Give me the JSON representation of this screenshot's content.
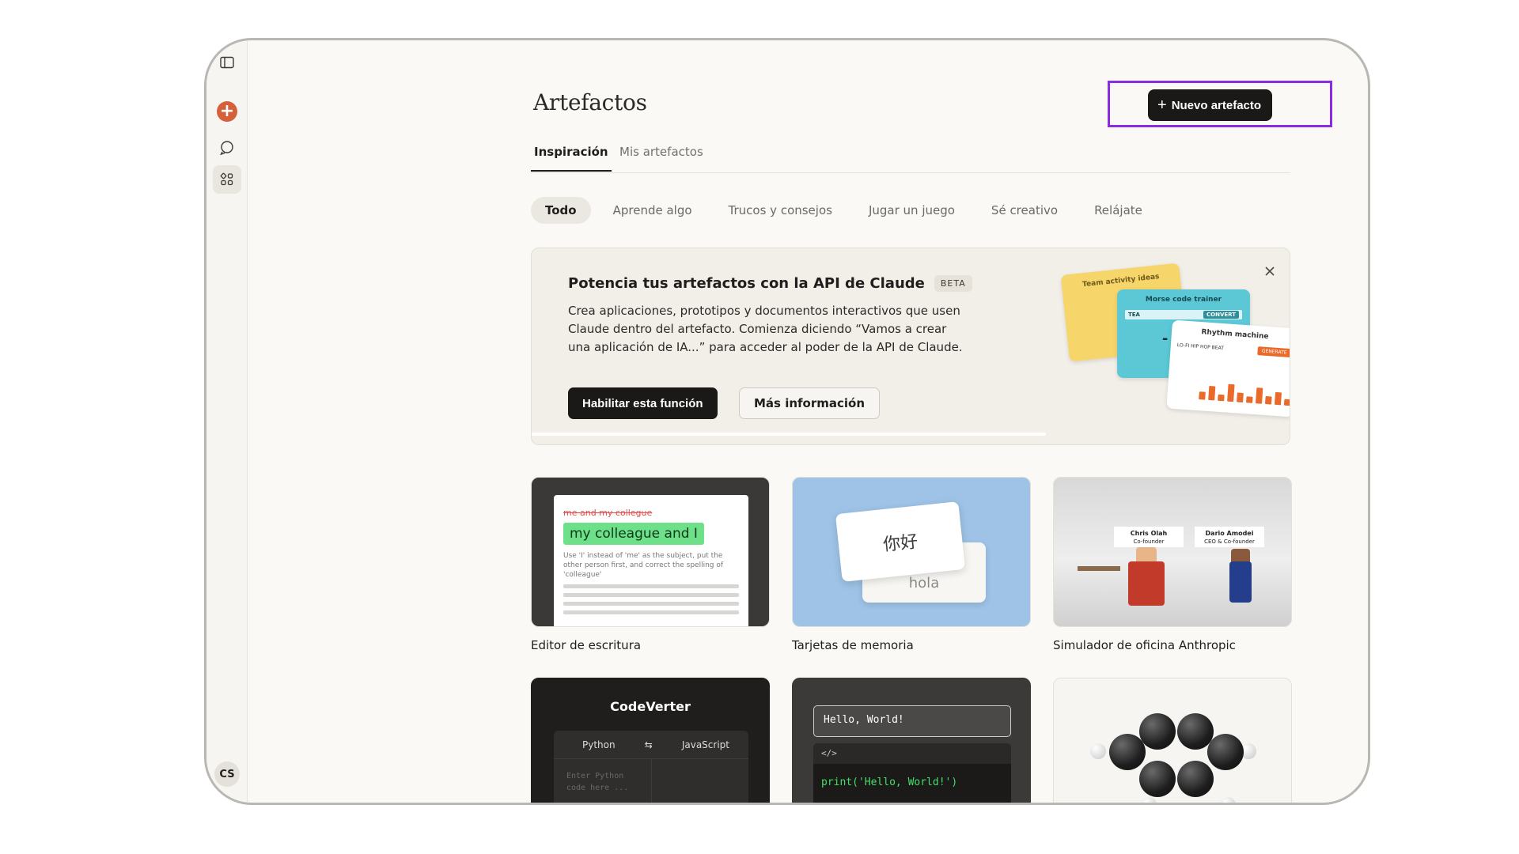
{
  "page": {
    "title": "Artefactos",
    "new_button": "Nuevo artefacto"
  },
  "sidebar": {
    "avatar_initials": "CS",
    "icons": [
      "sidebar-toggle-icon",
      "plus-icon",
      "chat-icon",
      "artifacts-grid-icon"
    ]
  },
  "tabs": [
    {
      "label": "Inspiración",
      "active": true
    },
    {
      "label": "Mis artefactos",
      "active": false
    }
  ],
  "filters": [
    {
      "label": "Todo",
      "active": true
    },
    {
      "label": "Aprende algo",
      "active": false
    },
    {
      "label": "Trucos y consejos",
      "active": false
    },
    {
      "label": "Jugar un juego",
      "active": false
    },
    {
      "label": "Sé creativo",
      "active": false
    },
    {
      "label": "Relájate",
      "active": false
    }
  ],
  "banner": {
    "title": "Potencia tus artefactos con la API de Claude",
    "badge": "BETA",
    "description": "Crea aplicaciones, prototipos y documentos interactivos que usen Claude dentro del artefacto. Comienza diciendo “Vamos a crear una aplicación de IA...” para acceder al poder de la API de Claude.",
    "primary_button": "Habilitar esta función",
    "secondary_button": "Más información",
    "preview": {
      "card1": "Team activity ideas",
      "card2": "Morse code trainer",
      "card2_field": "TEA",
      "card2_button": "CONVERT",
      "card2_dots": "- . -",
      "card3": "Rhythm machine",
      "card3_field": "LO-FI HIP HOP BEAT",
      "card3_button": "GENERATE"
    }
  },
  "cards": [
    {
      "label": "Editor de escritura",
      "preview": {
        "strike": "me and my collegue",
        "highlight": "my colleague and I",
        "note": "Use 'I' instead of 'me' as the subject, put the other person first, and correct the spelling of 'colleague'"
      }
    },
    {
      "label": "Tarjetas de memoria",
      "preview": {
        "front": "你好",
        "back": "hola"
      }
    },
    {
      "label": "Simulador de oficina Anthropic",
      "preview": {
        "sign1_name": "Chris Olah",
        "sign1_role": "Co-founder",
        "sign2_name": "Dario Amodei",
        "sign2_role": "CEO & Co-founder"
      }
    },
    {
      "label": "",
      "preview": {
        "title": "CodeVerter",
        "from": "Python",
        "swap": "⇆",
        "to": "JavaScript",
        "placeholder1": "Enter Python",
        "placeholder2": "code here ..."
      }
    },
    {
      "label": "",
      "preview": {
        "input": "Hello, World!",
        "tag": "</>",
        "code": "print('Hello, World!')"
      }
    },
    {
      "label": "",
      "preview": {}
    }
  ],
  "colors": {
    "accent": "#d4613b",
    "highlight_frame": "#8a2be2",
    "dark_button": "#1a1918"
  }
}
